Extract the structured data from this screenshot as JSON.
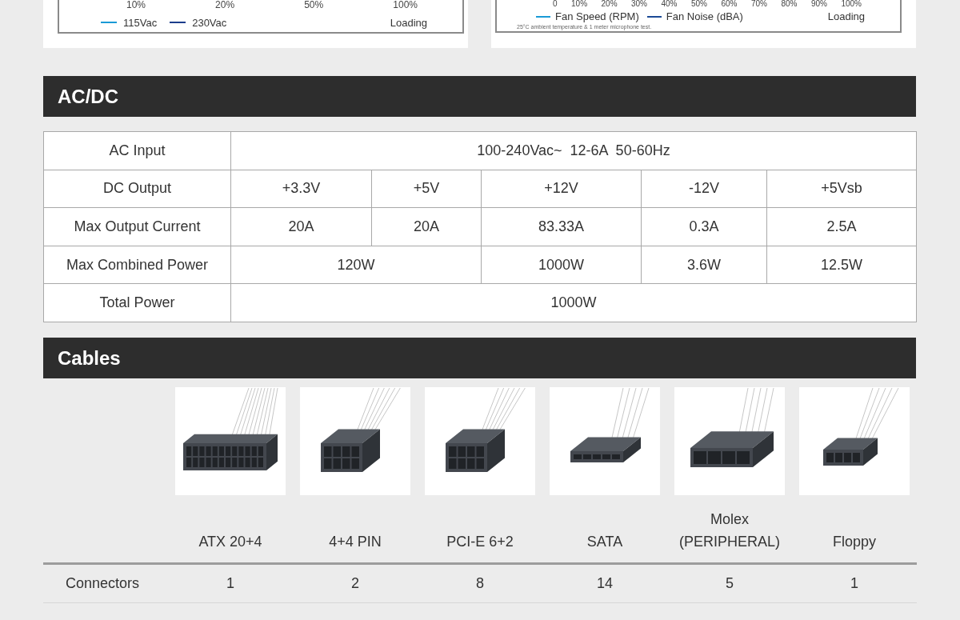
{
  "charts": [
    {
      "ticks": [
        "10%",
        "20%",
        "50%",
        "100%"
      ],
      "legend": [
        {
          "label": "115Vac",
          "color": "#1a9ad6"
        },
        {
          "label": "230Vac",
          "color": "#1b3d8c"
        }
      ],
      "axis_label": "Loading"
    },
    {
      "ticks": [
        "0",
        "10%",
        "20%",
        "30%",
        "40%",
        "50%",
        "60%",
        "70%",
        "80%",
        "90%",
        "100%"
      ],
      "legend": [
        {
          "label": "Fan Speed (RPM)",
          "color": "#1a9ad6"
        },
        {
          "label": "Fan Noise (dBA)",
          "color": "#1b4a96"
        }
      ],
      "axis_label": "Loading",
      "note": "25°C ambient temperature & 1 meter microphone test."
    }
  ],
  "acdc": {
    "title": "AC/DC",
    "rows": [
      {
        "label": "AC Input",
        "cells": [
          {
            "text": "100-240Vac~  12-6A  50-60Hz",
            "colspan": 5
          }
        ]
      },
      {
        "label": "DC Output",
        "cells": [
          {
            "text": "+3.3V"
          },
          {
            "text": "+5V"
          },
          {
            "text": "+12V"
          },
          {
            "text": "-12V"
          },
          {
            "text": "+5Vsb"
          }
        ]
      },
      {
        "label": "Max Output Current",
        "cells": [
          {
            "text": "20A"
          },
          {
            "text": "20A"
          },
          {
            "text": "83.33A"
          },
          {
            "text": "0.3A"
          },
          {
            "text": "2.5A"
          }
        ]
      },
      {
        "label": "Max Combined Power",
        "cells": [
          {
            "text": "120W",
            "colspan": 2
          },
          {
            "text": "1000W"
          },
          {
            "text": "3.6W"
          },
          {
            "text": "12.5W"
          }
        ]
      },
      {
        "label": "Total Power",
        "cells": [
          {
            "text": "1000W",
            "colspan": 5
          }
        ]
      }
    ]
  },
  "cables": {
    "title": "Cables",
    "columns": [
      {
        "label": "ATX 20+4",
        "kind": "atx"
      },
      {
        "label": "4+4 PIN",
        "kind": "pin8"
      },
      {
        "label": "PCI-E 6+2",
        "kind": "pin8"
      },
      {
        "label": "SATA",
        "kind": "sata"
      },
      {
        "label": "Molex (PERIPHERAL)",
        "kind": "molex"
      },
      {
        "label": "Floppy",
        "kind": "floppy"
      }
    ],
    "rows": [
      {
        "label": "Connectors",
        "values": [
          "1",
          "2",
          "8",
          "14",
          "5",
          "1"
        ]
      }
    ]
  }
}
